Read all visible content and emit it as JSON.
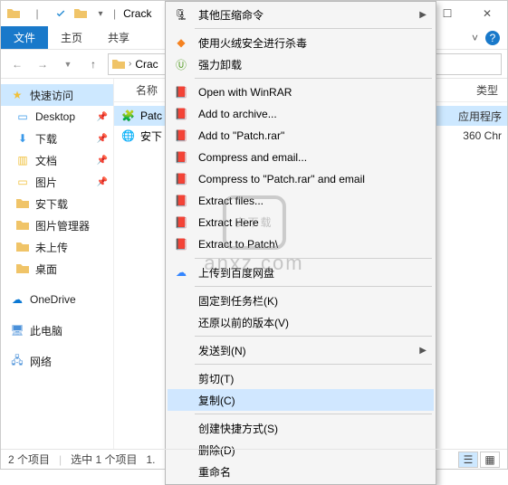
{
  "title": "Crack",
  "ribbon": {
    "file": "文件",
    "home": "主页",
    "share": "共享",
    "help": "?"
  },
  "breadcrumb": {
    "path": "Crac"
  },
  "columns": {
    "name": "名称",
    "type": "类型"
  },
  "nav": {
    "quick": "快速访问",
    "items": [
      "Desktop",
      "下载",
      "文档",
      "图片",
      "安下载",
      "图片管理器",
      "未上传",
      "桌面"
    ],
    "onedrive": "OneDrive",
    "thispc": "此电脑",
    "network": "网络"
  },
  "files": [
    {
      "name": "Patc",
      "type": "应用程序"
    },
    {
      "name": "安下",
      "type": "360 Chr"
    }
  ],
  "ctx": {
    "other_compress": "其他压缩命令",
    "huorong": "使用火绒安全进行杀毒",
    "force_uninstall": "强力卸载",
    "open_winrar": "Open with WinRAR",
    "add_archive": "Add to archive...",
    "add_patch": "Add to \"Patch.rar\"",
    "compress_email": "Compress and email...",
    "compress_patch_email": "Compress to \"Patch.rar\" and email",
    "extract_files": "Extract files...",
    "extract_here": "Extract Here",
    "extract_to": "Extract to Patch\\",
    "baidu": "上传到百度网盘",
    "pin_task": "固定到任务栏(K)",
    "restore": "还原以前的版本(V)",
    "sendto": "发送到(N)",
    "cut": "剪切(T)",
    "copy": "复制(C)",
    "shortcut": "创建快捷方式(S)",
    "delete": "删除(D)",
    "rename": "重命名"
  },
  "status": {
    "count": "2 个项目",
    "sel": "选中 1 个项目",
    "size": "1."
  },
  "watermark": {
    "text": "安下载",
    "url": "anxz.com"
  }
}
